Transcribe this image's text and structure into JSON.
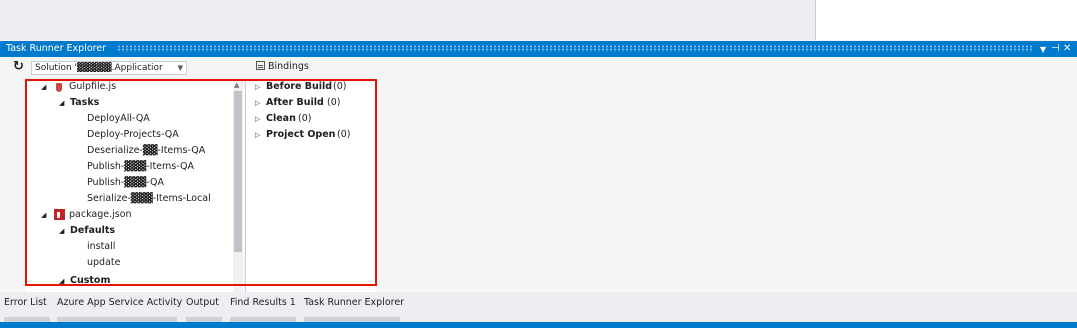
{
  "window": {
    "title": "Task Runner Explorer",
    "controls": {
      "menu": "▼",
      "pin": "⊣",
      "close": "✕"
    }
  },
  "toolbar": {
    "refresh_icon": "↻",
    "solution_value": "Solution '▓▓▓▓▓.Applicatior",
    "bindings_label": "Bindings"
  },
  "tree": {
    "gulpfile": {
      "label": "Gulpfile.js",
      "icon": "gulp-icon"
    },
    "tasks": {
      "label": "Tasks",
      "items": [
        "DeployAll-QA",
        "Deploy-Projects-QA",
        "Deserialize-▓▓-Items-QA",
        "Publish-▓▓▓-Items-QA",
        "Publish-▓▓▓-QA",
        "Serialize-▓▓▓-Items-Local"
      ]
    },
    "package": {
      "label": "package.json",
      "icon": "npm-icon"
    },
    "defaults": {
      "label": "Defaults",
      "items": [
        "install",
        "update"
      ]
    },
    "custom": {
      "label": "Custom"
    }
  },
  "bindings": [
    {
      "label": "Before Build",
      "count": "(0)"
    },
    {
      "label": "After Build",
      "count": "(0)"
    },
    {
      "label": "Clean",
      "count": "(0)"
    },
    {
      "label": "Project Open",
      "count": "(0)"
    }
  ],
  "bottom_tabs": [
    "Error List",
    "Azure App Service Activity",
    "Output",
    "Find Results 1",
    "Task Runner Explorer"
  ],
  "colors": {
    "accent": "#007acc",
    "highlight_border": "#e51400",
    "gulp_red": "#cf4646",
    "npm_red": "#c12127"
  }
}
